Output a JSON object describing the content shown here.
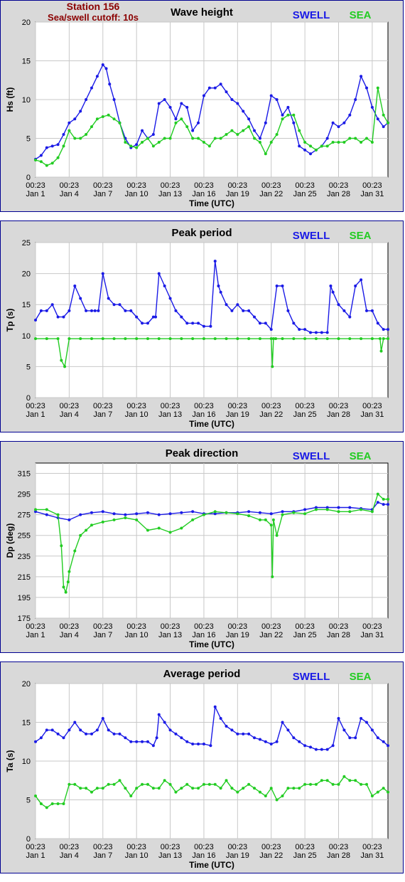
{
  "colors": {
    "swell": "#1a1ae6",
    "sea": "#22cc22",
    "station": "#8b0000",
    "panel_bg": "#d9d9d9",
    "plot_bg": "#ffffff",
    "grid": "#c8c8c8"
  },
  "header": {
    "station": "Station 156",
    "cutoff": "Sea/swell cutoff: 10s"
  },
  "x_ticks": {
    "times": [
      "00:23",
      "00:23",
      "00:23",
      "00:23",
      "00:23",
      "00:23",
      "00:23",
      "00:23",
      "00:23",
      "00:23",
      "00:23"
    ],
    "dates": [
      "Jan 1",
      "Jan 4",
      "Jan 7",
      "Jan 10",
      "Jan 13",
      "Jan 16",
      "Jan 19",
      "Jan 22",
      "Jan 25",
      "Jan 28",
      "Jan 31"
    ],
    "values": [
      1,
      4,
      7,
      10,
      13,
      16,
      19,
      22,
      25,
      28,
      31
    ]
  },
  "chart_data": [
    {
      "type": "line",
      "title": "Wave height",
      "xlabel": "Time (UTC)",
      "ylabel": "Hs (ft)",
      "xlim": [
        1,
        32.4
      ],
      "ylim": [
        0,
        20
      ],
      "yticks": [
        "0",
        "5",
        "10",
        "15",
        "20"
      ],
      "ytick_values": [
        0,
        5,
        10,
        15,
        20
      ],
      "grid": true,
      "legend": [
        "SWELL",
        "SEA"
      ],
      "legend_placement": "top-right",
      "series": [
        {
          "name": "SWELL",
          "x": [
            1,
            1.5,
            2,
            2.5,
            3,
            3.5,
            4,
            4.5,
            5,
            5.5,
            6,
            6.5,
            7,
            7.3,
            7.6,
            8,
            8.5,
            9,
            9.5,
            10,
            10.5,
            11,
            11.5,
            12,
            12.5,
            13,
            13.5,
            14,
            14.5,
            15,
            15.5,
            16,
            16.5,
            17,
            17.5,
            18,
            18.5,
            19,
            19.5,
            20,
            20.5,
            21,
            21.5,
            22,
            22.5,
            23,
            23.5,
            24,
            24.5,
            25,
            25.5,
            26,
            26.5,
            27,
            27.5,
            28,
            28.5,
            29,
            29.5,
            30,
            30.5,
            31,
            31.5,
            32,
            32.4
          ],
          "y": [
            2.3,
            2.8,
            3.8,
            4.0,
            4.2,
            5.5,
            7.0,
            7.5,
            8.5,
            10.0,
            11.5,
            13.0,
            14.5,
            14.0,
            12.0,
            10.0,
            7.0,
            5.0,
            3.8,
            4.2,
            6.0,
            5.0,
            5.5,
            9.5,
            10.0,
            9.0,
            7.5,
            9.5,
            9.0,
            6.0,
            7.0,
            10.5,
            11.5,
            11.5,
            12.0,
            11.0,
            10.0,
            9.5,
            8.5,
            7.5,
            6.0,
            5.0,
            7.0,
            10.5,
            10.0,
            8.0,
            9.0,
            7.0,
            4.0,
            3.5,
            3.0,
            3.5,
            4.0,
            5.0,
            7.0,
            6.5,
            7.0,
            8.0,
            10.0,
            13.0,
            11.5,
            9.0,
            7.5,
            6.5,
            7.0
          ]
        },
        {
          "name": "SEA",
          "x": [
            1,
            1.5,
            2,
            2.5,
            3,
            3.5,
            4,
            4.5,
            5,
            5.5,
            6,
            6.5,
            7,
            7.5,
            8,
            8.5,
            9,
            9.5,
            10,
            10.5,
            11,
            11.5,
            12,
            12.5,
            13,
            13.5,
            14,
            14.5,
            15,
            15.5,
            16,
            16.5,
            17,
            17.5,
            18,
            18.5,
            19,
            19.5,
            20,
            20.5,
            21,
            21.5,
            22,
            22.5,
            23,
            23.5,
            24,
            24.5,
            25,
            25.5,
            26,
            26.5,
            27,
            27.5,
            28,
            28.5,
            29,
            29.5,
            30,
            30.5,
            31,
            31.5,
            32,
            32.4
          ],
          "y": [
            2.2,
            2.0,
            1.5,
            1.8,
            2.5,
            4.0,
            6.0,
            5.0,
            5.0,
            5.5,
            6.5,
            7.5,
            7.8,
            8.0,
            7.5,
            7.0,
            4.5,
            4.0,
            3.8,
            4.5,
            5.0,
            4.0,
            4.5,
            5.0,
            5.0,
            7.0,
            7.5,
            6.5,
            5.0,
            5.0,
            4.5,
            4.0,
            5.0,
            5.0,
            5.5,
            6.0,
            5.5,
            6.0,
            6.5,
            5.0,
            4.5,
            3.0,
            4.5,
            5.5,
            7.5,
            8.0,
            8.0,
            6.0,
            4.5,
            4.0,
            3.5,
            4.0,
            4.0,
            4.5,
            4.5,
            4.5,
            5.0,
            5.0,
            4.5,
            5.0,
            4.5,
            11.5,
            8.0,
            7.0
          ]
        }
      ]
    },
    {
      "type": "line",
      "title": "Peak period",
      "xlabel": "Time (UTC)",
      "ylabel": "Tp (s)",
      "xlim": [
        1,
        32.4
      ],
      "ylim": [
        0,
        25
      ],
      "yticks": [
        "0",
        "5",
        "10",
        "15",
        "20",
        "25"
      ],
      "ytick_values": [
        0,
        5,
        10,
        15,
        20,
        25
      ],
      "grid": true,
      "legend": [
        "SWELL",
        "SEA"
      ],
      "legend_placement": "top-right",
      "series": [
        {
          "name": "SWELL",
          "x": [
            1,
            1.5,
            2,
            2.5,
            3,
            3.5,
            4,
            4.5,
            5,
            5.5,
            6,
            6.3,
            6.6,
            7,
            7.5,
            8,
            8.5,
            9,
            9.5,
            10,
            10.5,
            11,
            11.5,
            11.7,
            12,
            12.5,
            13,
            13.5,
            14,
            14.5,
            15,
            15.5,
            16,
            16.6,
            17,
            17.3,
            17.5,
            18,
            18.5,
            19,
            19.5,
            20,
            20.5,
            21,
            21.5,
            22,
            22.5,
            23,
            23.5,
            24,
            24.5,
            25,
            25.5,
            26,
            26.5,
            27,
            27.3,
            27.5,
            28,
            28.5,
            29,
            29.5,
            30,
            30.5,
            31,
            31.5,
            32,
            32.4
          ],
          "y": [
            12.5,
            14,
            14,
            15,
            13,
            13,
            14,
            18,
            16,
            14,
            14,
            14,
            14,
            20,
            16,
            15,
            15,
            14,
            14,
            13,
            12,
            12,
            13,
            13,
            20,
            18,
            16,
            14,
            13,
            12,
            12,
            12,
            11.5,
            11.5,
            22,
            18,
            17,
            15,
            14,
            15,
            14,
            14,
            13,
            12,
            12,
            11,
            18,
            18,
            14,
            12,
            11,
            11,
            10.5,
            10.5,
            10.5,
            10.5,
            18,
            17,
            15,
            14,
            13,
            18,
            19,
            14,
            14,
            12,
            11,
            11
          ]
        },
        {
          "name": "SEA",
          "x": [
            1,
            2,
            3,
            3.3,
            3.6,
            4,
            5,
            6,
            7,
            8,
            9,
            10,
            11,
            12,
            13,
            14,
            15,
            16,
            17,
            18,
            19,
            20,
            21,
            22,
            22.1,
            22.2,
            22.4,
            23,
            24,
            25,
            26,
            27,
            28,
            29,
            30,
            31,
            31.7,
            31.8,
            32,
            32.4
          ],
          "y": [
            9.5,
            9.5,
            9.5,
            6,
            5,
            9.5,
            9.5,
            9.5,
            9.5,
            9.5,
            9.5,
            9.5,
            9.5,
            9.5,
            9.5,
            9.5,
            9.5,
            9.5,
            9.5,
            9.5,
            9.5,
            9.5,
            9.5,
            9.5,
            5,
            9.5,
            9.5,
            9.5,
            9.5,
            9.5,
            9.5,
            9.5,
            9.5,
            9.5,
            9.5,
            9.5,
            9.5,
            7.5,
            9.5,
            9.5
          ]
        }
      ]
    },
    {
      "type": "line",
      "title": "Peak direction",
      "xlabel": "Time (UTC)",
      "ylabel": "Dp (deg)",
      "xlim": [
        1,
        32.4
      ],
      "ylim": [
        175,
        325
      ],
      "yticks": [
        "175",
        "195",
        "215",
        "235",
        "255",
        "275",
        "295",
        "315"
      ],
      "ytick_values": [
        175,
        195,
        215,
        235,
        255,
        275,
        295,
        315
      ],
      "grid": true,
      "legend": [
        "SWELL",
        "SEA"
      ],
      "legend_placement": "top-right",
      "series": [
        {
          "name": "SWELL",
          "x": [
            1,
            2,
            3,
            4,
            5,
            6,
            7,
            8,
            9,
            10,
            11,
            12,
            13,
            14,
            15,
            16,
            17,
            18,
            19,
            20,
            21,
            22,
            23,
            24,
            25,
            26,
            27,
            28,
            29,
            30,
            31,
            31.5,
            32,
            32.4
          ],
          "y": [
            278,
            275,
            272,
            270,
            275,
            277,
            278,
            276,
            275,
            276,
            277,
            275,
            276,
            277,
            278,
            276,
            276,
            277,
            277,
            278,
            277,
            276,
            278,
            278,
            280,
            282,
            282,
            282,
            282,
            281,
            280,
            287,
            285,
            285
          ]
        },
        {
          "name": "SEA",
          "x": [
            1,
            2,
            3,
            3.3,
            3.5,
            3.7,
            3.9,
            4,
            4.5,
            5,
            5.5,
            6,
            7,
            8,
            9,
            10,
            11,
            12,
            13,
            14,
            15,
            16,
            17,
            18,
            19,
            20,
            21,
            21.5,
            22,
            22.1,
            22.2,
            22.5,
            23,
            24,
            25,
            26,
            27,
            28,
            29,
            30,
            31,
            31.5,
            32,
            32.4
          ],
          "y": [
            280,
            280,
            275,
            245,
            205,
            200,
            210,
            220,
            240,
            255,
            260,
            265,
            268,
            270,
            272,
            270,
            260,
            262,
            258,
            262,
            270,
            275,
            278,
            277,
            276,
            274,
            270,
            270,
            265,
            215,
            270,
            255,
            275,
            277,
            276,
            280,
            280,
            278,
            278,
            280,
            278,
            295,
            290,
            290
          ]
        }
      ]
    },
    {
      "type": "line",
      "title": "Average period",
      "xlabel": "Time (UTC)",
      "ylabel": "Ta (s)",
      "xlim": [
        1,
        32.4
      ],
      "ylim": [
        0,
        20
      ],
      "yticks": [
        "0",
        "5",
        "10",
        "15",
        "20"
      ],
      "ytick_values": [
        0,
        5,
        10,
        15,
        20
      ],
      "grid": true,
      "legend": [
        "SWELL",
        "SEA"
      ],
      "legend_placement": "top-right",
      "series": [
        {
          "name": "SWELL",
          "x": [
            1,
            1.5,
            2,
            2.5,
            3,
            3.5,
            4,
            4.5,
            5,
            5.5,
            6,
            6.5,
            7,
            7.5,
            8,
            8.5,
            9,
            9.5,
            10,
            10.5,
            11,
            11.5,
            11.8,
            12,
            12.5,
            13,
            13.5,
            14,
            14.5,
            15,
            15.5,
            16,
            16.6,
            17,
            17.5,
            18,
            18.5,
            19,
            19.5,
            20,
            20.5,
            21,
            21.5,
            22,
            22.5,
            23,
            23.5,
            24,
            24.5,
            25,
            25.5,
            26,
            26.5,
            27,
            27.5,
            28,
            28.5,
            29,
            29.5,
            30,
            30.5,
            31,
            31.5,
            32,
            32.4
          ],
          "y": [
            12.5,
            13,
            14,
            14,
            13.5,
            13,
            14,
            15,
            14,
            13.5,
            13.5,
            14,
            15.5,
            14,
            13.5,
            13.5,
            13,
            12.5,
            12.5,
            12.5,
            12.5,
            12,
            13,
            16,
            15,
            14,
            13.5,
            13,
            12.5,
            12.2,
            12.2,
            12.2,
            12,
            17,
            15.5,
            14.5,
            14,
            13.5,
            13.5,
            13.5,
            13,
            12.8,
            12.5,
            12.2,
            12.5,
            15,
            14,
            13,
            12.5,
            12,
            11.8,
            11.5,
            11.5,
            11.5,
            12,
            15.5,
            14,
            13,
            13,
            15.5,
            15,
            14,
            13,
            12.5,
            12
          ]
        },
        {
          "name": "SEA",
          "x": [
            1,
            1.5,
            2,
            2.5,
            3,
            3.5,
            4,
            4.5,
            5,
            5.5,
            6,
            6.5,
            7,
            7.5,
            8,
            8.5,
            9,
            9.5,
            10,
            10.5,
            11,
            11.5,
            12,
            12.5,
            13,
            13.5,
            14,
            14.5,
            15,
            15.5,
            16,
            16.5,
            17,
            17.5,
            18,
            18.5,
            19,
            19.5,
            20,
            20.5,
            21,
            21.5,
            22,
            22.5,
            23,
            23.5,
            24,
            24.5,
            25,
            25.5,
            26,
            26.5,
            27,
            27.5,
            28,
            28.5,
            29,
            29.5,
            30,
            30.5,
            31,
            31.5,
            32,
            32.4
          ],
          "y": [
            5.5,
            4.5,
            4,
            4.5,
            4.5,
            4.5,
            7,
            7,
            6.5,
            6.5,
            6,
            6.5,
            6.5,
            7,
            7,
            7.5,
            6.5,
            5.5,
            6.5,
            7,
            7,
            6.5,
            6.5,
            7.5,
            7,
            6,
            6.5,
            7,
            6.5,
            6.5,
            7,
            7,
            7,
            6.5,
            7.5,
            6.5,
            6,
            6.5,
            7,
            6.5,
            6,
            5.5,
            6.5,
            5,
            5.5,
            6.5,
            6.5,
            6.5,
            7,
            7,
            7,
            7.5,
            7.5,
            7,
            7,
            8,
            7.5,
            7.5,
            7,
            7,
            5.5,
            6,
            6.5,
            6
          ]
        }
      ]
    }
  ]
}
